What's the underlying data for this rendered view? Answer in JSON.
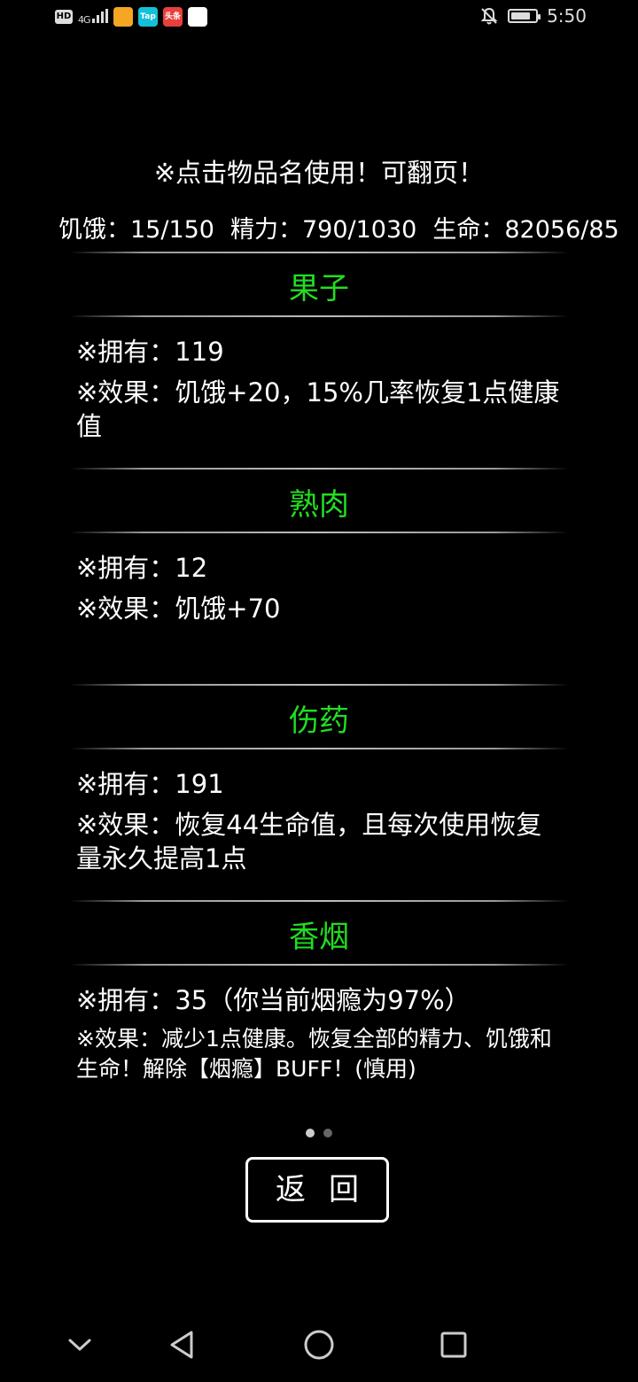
{
  "status_bar": {
    "hd": "HD",
    "network": "4G",
    "apps": [
      {
        "name": "weibo-app-icon",
        "label": "",
        "color": "#f5a623"
      },
      {
        "name": "taptap-app-icon",
        "label": "Tap",
        "color": "#14c0d8"
      },
      {
        "name": "toutiao-app-icon",
        "label": "头条",
        "color": "#e8403b"
      },
      {
        "name": "maps-app-icon",
        "label": "",
        "color": "#ffffff"
      }
    ],
    "time": "5:50",
    "battery_level": 0.8
  },
  "hint": "※点击物品名使用！可翻页！",
  "stats": {
    "hunger": "饥饿：15/150",
    "energy": "精力：790/1030",
    "life": "生命：82056/85"
  },
  "items": [
    {
      "name": "果子",
      "owned": "※拥有：119",
      "effect": "※效果：饥饿+20，15%几率恢复1点健康值"
    },
    {
      "name": "熟肉",
      "owned": "※拥有：12",
      "effect": "※效果：饥饿+70"
    },
    {
      "name": "伤药",
      "owned": "※拥有：191",
      "effect": "※效果：恢复44生命值，且每次使用恢复量永久提高1点"
    },
    {
      "name": "香烟",
      "owned": "※拥有：35（你当前烟瘾为97%）",
      "effect": "※效果：减少1点健康。恢复全部的精力、饥饿和生命！解除【烟瘾】BUFF！(慎用)"
    }
  ],
  "pager": {
    "pages": 2,
    "current": 1
  },
  "back_button": "返回",
  "colors": {
    "item_name": "#22dd22",
    "background": "#000000",
    "text": "#ffffff"
  }
}
